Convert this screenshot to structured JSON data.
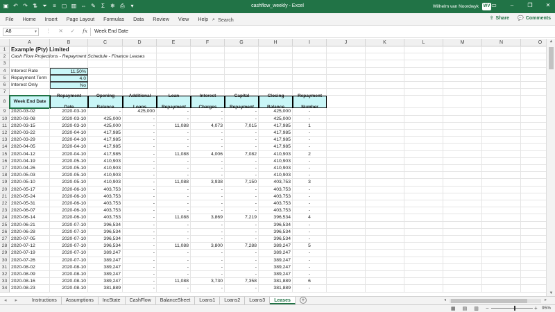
{
  "titlebar": {
    "doc_title": "cashflow_weekly  -  Excel",
    "user_name": "Wilhelm van Noordwyk",
    "user_initials": "WV",
    "qat_icons": [
      "save-icon",
      "undo-icon",
      "redo-icon",
      "sort-icon",
      "filter-icon",
      "format-icon",
      "borders-icon",
      "chart-icon",
      "merge-icon",
      "paint-icon",
      "sum-icon",
      "freeze-icon",
      "print-icon",
      "more-icon"
    ]
  },
  "menu": {
    "items": [
      "File",
      "Home",
      "Insert",
      "Page Layout",
      "Formulas",
      "Data",
      "Review",
      "View",
      "Help"
    ],
    "search": "Search",
    "share": "Share",
    "comments": "Comments"
  },
  "formula_bar": {
    "name_box": "A8",
    "content": "Week End Date"
  },
  "columns": [
    "A",
    "B",
    "C",
    "D",
    "E",
    "F",
    "G",
    "H",
    "I",
    "J",
    "K",
    "L",
    "M",
    "N",
    "O"
  ],
  "sheet": {
    "title": "Example (Pty) Limited",
    "subtitle": "Cash Flow Projections - Repayment Schedule - Finance Leases",
    "inputs": [
      {
        "label": "Interest Rate",
        "value": "11.50%"
      },
      {
        "label": "Repayment Term",
        "value": "4.0"
      },
      {
        "label": "Interest Only",
        "value": "No"
      }
    ],
    "table_headers": [
      "Week End Date",
      "Repayment Date",
      "Opening Balance",
      "Additional Loans",
      "Loan Repayment",
      "Interest Charges",
      "Capital Repayment",
      "Closing Balance",
      "Repayment Number"
    ],
    "rows": [
      [
        "2020-03-02",
        "2020-03-10",
        "-",
        "425,000",
        "-",
        "-",
        "-",
        "425,000",
        "-"
      ],
      [
        "2020-03-08",
        "2020-03-10",
        "425,000",
        "-",
        "-",
        "-",
        "-",
        "425,000",
        "-"
      ],
      [
        "2020-03-15",
        "2020-03-10",
        "425,000",
        "-",
        "11,088",
        "4,073",
        "7,015",
        "417,985",
        "1"
      ],
      [
        "2020-03-22",
        "2020-04-10",
        "417,985",
        "-",
        "-",
        "-",
        "-",
        "417,985",
        "-"
      ],
      [
        "2020-03-29",
        "2020-04-10",
        "417,985",
        "-",
        "-",
        "-",
        "-",
        "417,985",
        "-"
      ],
      [
        "2020-04-05",
        "2020-04-10",
        "417,985",
        "-",
        "-",
        "-",
        "-",
        "417,985",
        "-"
      ],
      [
        "2020-04-12",
        "2020-04-10",
        "417,985",
        "-",
        "11,088",
        "4,006",
        "7,082",
        "410,903",
        "2"
      ],
      [
        "2020-04-19",
        "2020-05-10",
        "410,903",
        "-",
        "-",
        "-",
        "-",
        "410,903",
        "-"
      ],
      [
        "2020-04-26",
        "2020-05-10",
        "410,903",
        "-",
        "-",
        "-",
        "-",
        "410,903",
        "-"
      ],
      [
        "2020-05-03",
        "2020-05-10",
        "410,903",
        "-",
        "-",
        "-",
        "-",
        "410,903",
        "-"
      ],
      [
        "2020-05-10",
        "2020-05-10",
        "410,903",
        "-",
        "11,088",
        "3,938",
        "7,150",
        "403,753",
        "3"
      ],
      [
        "2020-05-17",
        "2020-06-10",
        "403,753",
        "-",
        "-",
        "-",
        "-",
        "403,753",
        "-"
      ],
      [
        "2020-05-24",
        "2020-06-10",
        "403,753",
        "-",
        "-",
        "-",
        "-",
        "403,753",
        "-"
      ],
      [
        "2020-05-31",
        "2020-06-10",
        "403,753",
        "-",
        "-",
        "-",
        "-",
        "403,753",
        "-"
      ],
      [
        "2020-06-07",
        "2020-06-10",
        "403,753",
        "-",
        "-",
        "-",
        "-",
        "403,753",
        "-"
      ],
      [
        "2020-06-14",
        "2020-06-10",
        "403,753",
        "-",
        "11,088",
        "3,869",
        "7,219",
        "396,534",
        "4"
      ],
      [
        "2020-06-21",
        "2020-07-10",
        "396,534",
        "-",
        "-",
        "-",
        "-",
        "396,534",
        "-"
      ],
      [
        "2020-06-28",
        "2020-07-10",
        "396,534",
        "-",
        "-",
        "-",
        "-",
        "396,534",
        "-"
      ],
      [
        "2020-07-05",
        "2020-07-10",
        "396,534",
        "-",
        "-",
        "-",
        "-",
        "396,534",
        "-"
      ],
      [
        "2020-07-12",
        "2020-07-10",
        "396,534",
        "-",
        "11,088",
        "3,800",
        "7,288",
        "389,247",
        "5"
      ],
      [
        "2020-07-19",
        "2020-07-10",
        "389,247",
        "-",
        "-",
        "-",
        "-",
        "389,247",
        "-"
      ],
      [
        "2020-07-26",
        "2020-07-10",
        "389,247",
        "-",
        "-",
        "-",
        "-",
        "389,247",
        "-"
      ],
      [
        "2020-08-02",
        "2020-08-10",
        "389,247",
        "-",
        "-",
        "-",
        "-",
        "389,247",
        "-"
      ],
      [
        "2020-08-09",
        "2020-08-10",
        "389,247",
        "-",
        "-",
        "-",
        "-",
        "389,247",
        "-"
      ],
      [
        "2020-08-16",
        "2020-08-10",
        "389,247",
        "-",
        "11,088",
        "3,730",
        "7,358",
        "381,889",
        "6"
      ],
      [
        "2020-08-23",
        "2020-08-10",
        "381,889",
        "-",
        "-",
        "-",
        "-",
        "381,889",
        "-"
      ]
    ]
  },
  "tabs": {
    "items": [
      "Instructions",
      "Assumptions",
      "IncState",
      "CashFlow",
      "BalanceSheet",
      "Loans1",
      "Loans2",
      "Loans3",
      "Leases"
    ],
    "active": "Leases"
  },
  "status": {
    "zoom": "95%"
  }
}
